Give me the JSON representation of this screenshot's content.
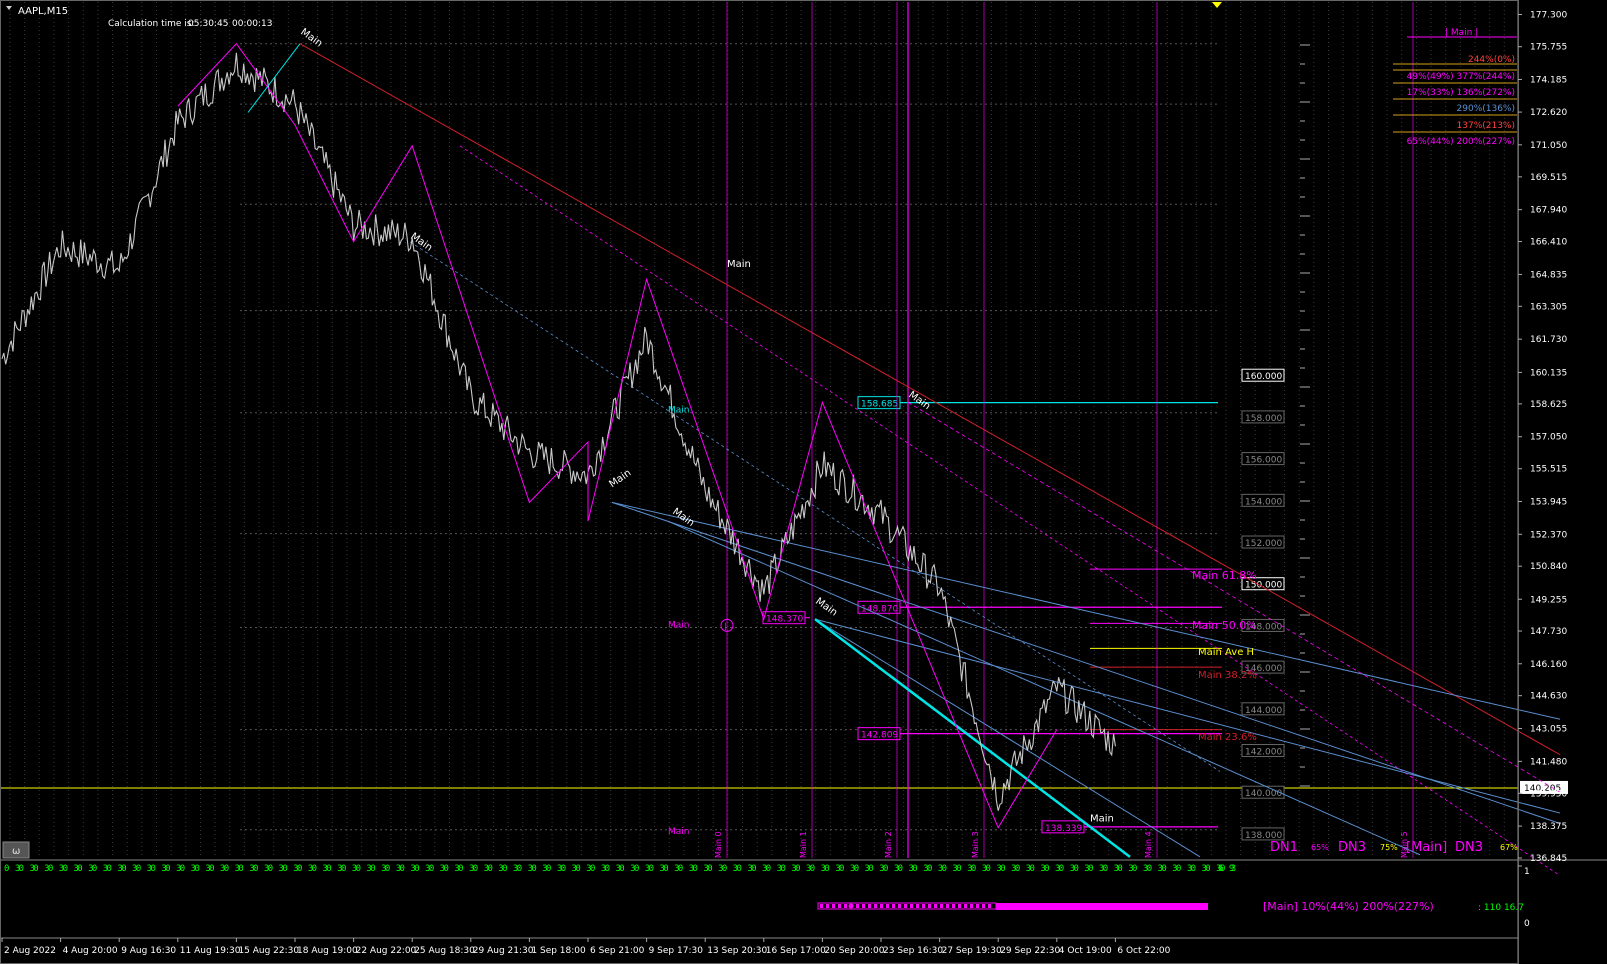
{
  "header": {
    "symbol": "AAPL,M15",
    "calc_label": "Calculation time is:",
    "calc_time": "05:30:45",
    "calc_elapsed": "00:00:13"
  },
  "colors": {
    "background": "#000000",
    "price": "#c8c8c8",
    "zigzag": "#ff00ff",
    "trend_red": "#d0202a",
    "fan_blue": "#5a8fd0",
    "cyan": "#00e5e5",
    "yellow": "#ffff00",
    "grid": "#3a3a3a",
    "text_gray": "#808080",
    "green": "#00ff00"
  },
  "chart_data": {
    "type": "line",
    "title": "",
    "ylim": [
      136.845,
      177.9
    ],
    "yticks": [
      "177.300",
      "175.755",
      "174.185",
      "172.620",
      "171.050",
      "169.515",
      "167.940",
      "166.410",
      "164.835",
      "163.305",
      "161.730",
      "160.135",
      "158.625",
      "157.050",
      "155.515",
      "153.945",
      "152.370",
      "150.840",
      "149.255",
      "147.730",
      "146.160",
      "144.630",
      "143.055",
      "141.480",
      "139.950",
      "138.375",
      "136.845"
    ],
    "xticks": [
      "2 Aug 2022",
      "4 Aug 20:00",
      "9 Aug 16:30",
      "11 Aug 19:30",
      "15 Aug 22:30",
      "18 Aug 19:00",
      "22 Aug 22:00",
      "25 Aug 18:30",
      "29 Aug 21:30",
      "1 Sep 18:00",
      "6 Sep 21:00",
      "9 Sep 17:30",
      "13 Sep 20:30",
      "16 Sep 17:00",
      "20 Sep 20:00",
      "23 Sep 16:30",
      "27 Sep 19:30",
      "29 Sep 22:30",
      "4 Oct 19:00",
      "6 Oct 22:00"
    ],
    "current_price": "140.205",
    "series": [
      {
        "x": [
          "2 Aug 2022",
          "4 Aug 20:00",
          "9 Aug 16:30",
          "11 Aug 19:30",
          "15 Aug 22:30",
          "18 Aug 19:00",
          "22 Aug 22:00",
          "25 Aug 18:30",
          "29 Aug 21:30",
          "1 Sep 18:00",
          "6 Sep 21:00",
          "9 Sep 17:30",
          "13 Sep 20:30",
          "16 Sep 17:00",
          "20 Sep 20:00",
          "23 Sep 16:30",
          "27 Sep 19:30",
          "29 Sep 22:30",
          "4 Oct 19:00",
          "6 Oct 22:00"
        ],
        "values": [
          160.8,
          166.2,
          165.1,
          172.1,
          175.0,
          173.0,
          167.2,
          166.6,
          159.0,
          156.3,
          155.2,
          161.8,
          154.5,
          149.6,
          155.7,
          153.3,
          149.8,
          139.8,
          145.0,
          142.2
        ]
      }
    ],
    "zigzag": [
      {
        "x": "11 Aug 19:30",
        "y": 172.9
      },
      {
        "x": "15 Aug 22:30",
        "y": 175.9
      },
      {
        "x": "18 Aug 19:00",
        "y": 172.0
      },
      {
        "x": "22 Aug 22:00",
        "y": 166.4
      },
      {
        "x": "25 Aug 18:30",
        "y": 171.0
      },
      {
        "x": "1 Sep 18:00",
        "y": 153.9
      },
      {
        "x": "6 Sep 21:00",
        "y": 156.8
      },
      {
        "x": "6 Sep 21:00",
        "y": 153.0
      },
      {
        "x": "9 Sep 17:30",
        "y": 164.6
      },
      {
        "x": "16 Sep 17:00",
        "y": 148.3
      },
      {
        "x": "20 Sep 20:00",
        "y": 158.7
      },
      {
        "x": "29 Sep 22:30",
        "y": 138.3
      },
      {
        "x": "4 Oct 19:00",
        "y": 143.0
      }
    ],
    "price_tags": [
      "160.000",
      "158.000",
      "156.000",
      "154.000",
      "152.000",
      "150.000",
      "148.000",
      "146.000",
      "144.000",
      "142.000",
      "140.000",
      "138.000"
    ],
    "boxed_labels": [
      "158.685",
      "148.870",
      "148.370",
      "142.809",
      "138.339"
    ],
    "zigzag_labels": [
      "Main",
      "Main",
      "Main",
      "Main",
      "Main",
      "Main",
      "Main",
      "Main"
    ],
    "fib_labels": {
      "f618": "Main 61.8%",
      "f50": "Main 50.0%",
      "aveh": "Main Ave H",
      "f382": "Main 38.2%",
      "f236": "Main 23.6%"
    },
    "vertical_labels": [
      "Main 0",
      "Main 1",
      "Main 2",
      "Main 3",
      "Main 4",
      "Main 5"
    ],
    "left_markers": [
      "Main",
      "Main",
      "Main"
    ],
    "legend": {
      "title": "| Main |",
      "rows": [
        "244%(0%)",
        "49%(49%)  377%(244%)",
        "17%(33%)  136%(272%)",
        "290%(136%)",
        "137%(213%)",
        "65%(44%)  200%(227%)"
      ]
    },
    "bottom_labels": {
      "dn1": "DN1",
      "dn1_pct": "65%",
      "dn3": "DN3",
      "dn3_pct": "75%",
      "main": "[Main]",
      "dn3b": "DN3",
      "dn3b_pct": "67%"
    },
    "subwindow": {
      "ylabel": "1",
      "ybottom": "0",
      "text": "[Main] 10%(44%)  200%(227%)",
      "counter": ": 110  16.7",
      "digits": "0 3",
      "last_digit": "6 9"
    }
  }
}
